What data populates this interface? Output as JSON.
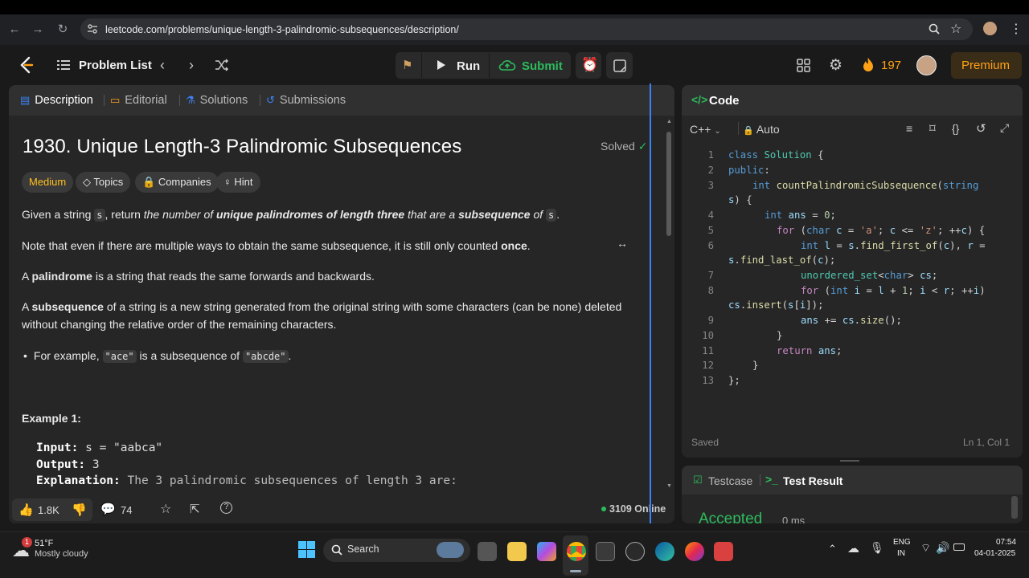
{
  "browser": {
    "url": "leetcode.com/problems/unique-length-3-palindromic-subsequences/description/"
  },
  "nav": {
    "problem_list": "Problem List",
    "run": "Run",
    "submit": "Submit",
    "streak": "197",
    "premium": "Premium"
  },
  "tabs": {
    "description": "Description",
    "editorial": "Editorial",
    "solutions": "Solutions",
    "submissions": "Submissions"
  },
  "problem": {
    "title": "1930. Unique Length-3 Palindromic Subsequences",
    "solved": "Solved",
    "difficulty": "Medium",
    "topics": "Topics",
    "companies": "Companies",
    "hint": "Hint",
    "p1_a": "Given a string ",
    "p1_s": "s",
    "p1_b": ", return ",
    "p1_c": "the number of ",
    "p1_d": "unique palindromes of length three",
    "p1_e": " that are a ",
    "p1_f": "subsequence",
    "p1_g": " of ",
    "p1_h": "s",
    "p1_i": ".",
    "p2_a": "Note that even if there are multiple ways to obtain the same subsequence, it is still only counted ",
    "p2_b": "once",
    "p2_c": ".",
    "p3_a": "A ",
    "p3_b": "palindrome",
    "p3_c": " is a string that reads the same forwards and backwards.",
    "p4_a": "A ",
    "p4_b": "subsequence",
    "p4_c": " of a string is a new string generated from the original string with some characters (can be none) deleted without changing the relative order of the remaining characters.",
    "bullet_a": "For example, ",
    "bullet_b": "\"ace\"",
    "bullet_c": " is a subsequence of ",
    "bullet_d": "\"abcde\"",
    "bullet_e": ".",
    "example_title": "Example 1:",
    "ex_input_label": "Input:",
    "ex_input_value": " s = \"aabca\"",
    "ex_output_label": "Output:",
    "ex_output_value": " 3",
    "ex_expl_label": "Explanation:",
    "ex_expl_value": " The 3 palindromic subsequences of length 3 are:"
  },
  "footer": {
    "likes": "1.8K",
    "comments": "74",
    "online": "3109 Online"
  },
  "code": {
    "header": "Code",
    "language": "C++",
    "mode": "Auto",
    "saved": "Saved",
    "position": "Ln 1, Col 1",
    "line_numbers": [
      "1",
      "2",
      "3",
      "4",
      "5",
      "6",
      "7",
      "8",
      "9",
      "10",
      "11",
      "12",
      "13"
    ]
  },
  "test": {
    "testcase": "Testcase",
    "result": "Test Result",
    "status": "Accepted",
    "runtime": "0 ms"
  },
  "taskbar": {
    "temp": "51°F",
    "weather": "Mostly cloudy",
    "badge": "1",
    "search": "Search",
    "lang_top": "ENG",
    "lang_bottom": "IN",
    "time": "07:54",
    "date": "04-01-2025"
  },
  "colors": {
    "accent_green": "#2cbb5d",
    "medium": "#ffc01e",
    "premium": "#ffa116",
    "blue": "#3b82f6"
  }
}
